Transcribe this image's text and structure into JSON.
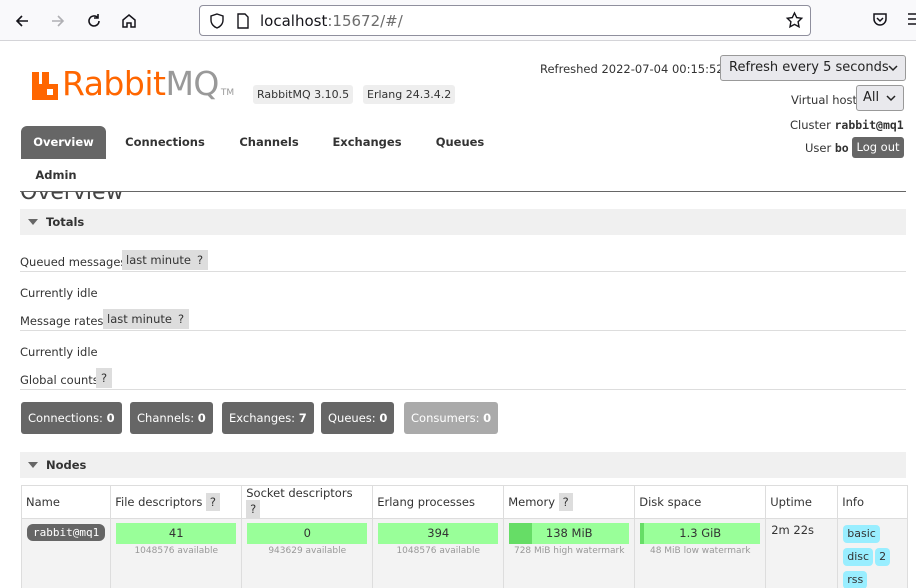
{
  "browser": {
    "url_host": "localhost",
    "url_rest": ":15672/#/"
  },
  "brand": {
    "name_primary": "Rabbit",
    "name_secondary": "MQ",
    "trademark": "TM",
    "accent_color": "#ff6600"
  },
  "versions": {
    "rabbitmq": "RabbitMQ 3.10.5",
    "erlang": "Erlang 24.3.4.2"
  },
  "header": {
    "refreshed_label": "Refreshed 2022-07-04 00:15:52",
    "refresh_interval": "Refresh every 5 seconds",
    "vhost_label": "Virtual host",
    "vhost_value": "All",
    "cluster_label": "Cluster",
    "cluster_name": "rabbit@mq1",
    "user_label": "User",
    "user_name": "bo",
    "logout_label": "Log out"
  },
  "tabs": [
    {
      "label": "Overview",
      "active": true
    },
    {
      "label": "Connections",
      "active": false
    },
    {
      "label": "Channels",
      "active": false
    },
    {
      "label": "Exchanges",
      "active": false
    },
    {
      "label": "Queues",
      "active": false
    },
    {
      "label": "Admin",
      "active": false
    }
  ],
  "page_title": "Overview",
  "totals": {
    "section_label": "Totals",
    "queued_messages_label": "Queued messages",
    "queued_messages_range": "last minute",
    "help": "?",
    "queued_status": "Currently idle",
    "message_rates_label": "Message rates",
    "message_rates_range": "last minute",
    "rates_status": "Currently idle",
    "global_counts_label": "Global counts"
  },
  "counts": [
    {
      "label": "Connections:",
      "value": "0"
    },
    {
      "label": "Channels:",
      "value": "0"
    },
    {
      "label": "Exchanges:",
      "value": "7"
    },
    {
      "label": "Queues:",
      "value": "0"
    },
    {
      "label": "Consumers:",
      "value": "0"
    }
  ],
  "nodes": {
    "section_label": "Nodes",
    "columns": [
      "Name",
      "File descriptors",
      "Socket descriptors",
      "Erlang processes",
      "Memory",
      "Disk space",
      "Uptime",
      "Info"
    ],
    "row": {
      "name": "rabbit@mq1",
      "file_descriptors": "41",
      "file_descriptors_sub": "1048576 available",
      "socket_descriptors": "0",
      "socket_descriptors_sub": "943629 available",
      "erlang_processes": "394",
      "erlang_processes_sub": "1048576 available",
      "memory": "138 MiB",
      "memory_sub": "728 MiB high watermark",
      "memory_fraction": 0.19,
      "disk_space": "1.3 GiB",
      "disk_space_sub": "48 MiB low watermark",
      "disk_fraction": 0.03,
      "uptime": "2m 22s",
      "info": [
        "basic",
        "disc",
        "2",
        "rss"
      ]
    }
  }
}
